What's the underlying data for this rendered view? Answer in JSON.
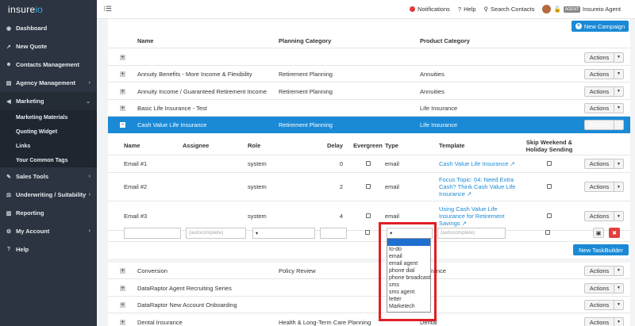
{
  "app": {
    "logo_part1": "insure",
    "logo_part2": "io"
  },
  "sidebar": {
    "items": [
      {
        "label": "Dashboard",
        "icon": "dashboard-icon",
        "glyph": "◉"
      },
      {
        "label": "New Quote",
        "icon": "rocket-icon",
        "glyph": "➚"
      },
      {
        "label": "Contacts Management",
        "icon": "users-icon",
        "glyph": "☻"
      },
      {
        "label": "Agency Management",
        "icon": "briefcase-icon",
        "glyph": "▤",
        "chevron": "›"
      },
      {
        "label": "Marketing",
        "icon": "bullhorn-icon",
        "glyph": "◀",
        "chevron": "⌄"
      },
      {
        "label": "Sales Tools",
        "icon": "wrench-icon",
        "glyph": "✎",
        "chevron": "›"
      },
      {
        "label": "Underwriting / Suitability",
        "icon": "balance-icon",
        "glyph": "⚖",
        "chevron": "›"
      },
      {
        "label": "Reporting",
        "icon": "chart-icon",
        "glyph": "▥"
      },
      {
        "label": "My Account",
        "icon": "gear-icon",
        "glyph": "⚙",
        "chevron": "›"
      },
      {
        "label": "Help",
        "icon": "question-icon",
        "glyph": "?"
      }
    ],
    "marketing_sub": [
      "Marketing Materials",
      "Quoting Widget",
      "Links",
      "Your Common Tags"
    ]
  },
  "topbar": {
    "menu_glyph": "⁝☰",
    "notifications": "Notifications",
    "help": "Help",
    "search": "Search Contacts",
    "agent_badge": "AGENT",
    "agent_name": "Insureio Agent"
  },
  "main": {
    "new_campaign": "New Campaign",
    "headers": {
      "name": "Name",
      "planning": "Planning Category",
      "product": "Product Category"
    },
    "actions_label": "Actions",
    "campaigns_top": [
      {
        "name": "",
        "planning": "",
        "product": ""
      },
      {
        "name": "Annuity Benefits - More Income & Flexibility",
        "planning": "Retirement Planning",
        "product": "Annuities"
      },
      {
        "name": "Annuity Income / Guaranteed Retirement Income",
        "planning": "Retirement Planning",
        "product": "Annuities"
      },
      {
        "name": "Basic Life Insurance - Test",
        "planning": "",
        "product": "Life Insurance"
      }
    ],
    "selected_campaign": {
      "name": "Cash Value Life Insurance",
      "planning": "Retirement Planning",
      "product": "Life Insurance"
    },
    "task_headers": {
      "name": "Name",
      "assignee": "Assignee",
      "role": "Role",
      "delay": "Delay",
      "evergreen": "Evergreen",
      "type": "Type",
      "template": "Template",
      "skip": "Skip Weekend & Holiday Sending"
    },
    "tasks": [
      {
        "name": "Email #1",
        "assignee": "",
        "role": "system",
        "delay": "0",
        "type": "email",
        "template_lines": [
          "Cash Value Life Insurance ↗"
        ]
      },
      {
        "name": "Email #2",
        "assignee": "",
        "role": "system",
        "delay": "2",
        "type": "email",
        "template_lines": [
          "Focus Topic: 04: Need Extra",
          "Cash? Think Cash Value Life",
          "Insurance ↗"
        ]
      },
      {
        "name": "Email #3",
        "assignee": "",
        "role": "system",
        "delay": "4",
        "type": "email",
        "template_lines": [
          "Using Cash Value Life",
          "Insurance for Retirement",
          "Savings ↗"
        ]
      }
    ],
    "new_task": {
      "assignee_placeholder": "(autocomplete)",
      "template_placeholder": "(autocomplete)"
    },
    "new_taskbuilder": "New TaskBuilder",
    "type_options": [
      "to-do",
      "email",
      "email agent",
      "phone dial",
      "phone broadcast",
      "sms",
      "sms agent",
      "letter",
      "Marketech"
    ],
    "campaigns_bottom": [
      {
        "name": "Conversion",
        "planning": "Policy Review",
        "product": "Insurance"
      },
      {
        "name": "DataRaptor Agent Recruiting Series",
        "planning": "",
        "product": ""
      },
      {
        "name": "DataRaptor New Account Onboarding",
        "planning": "",
        "product": ""
      },
      {
        "name": "Dental Insurance",
        "planning": "Health & Long-Term Care Planning",
        "product": "Dental"
      }
    ]
  },
  "colors": {
    "sidebar": "#2b3440",
    "accent": "#1a8ad6",
    "highlight": "#e01e25"
  }
}
